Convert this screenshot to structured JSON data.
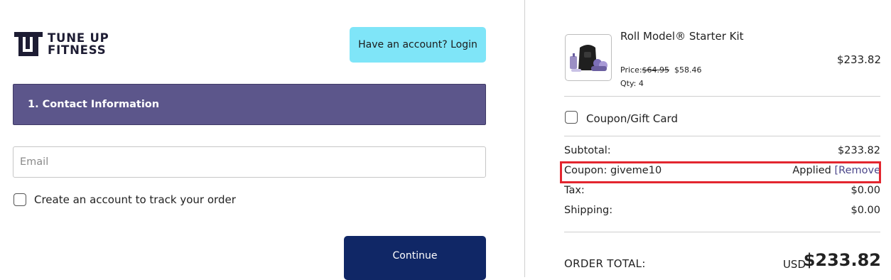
{
  "brand": {
    "line1": "TUNE UP",
    "line2": "FITNESS",
    "color": "#1d1c33"
  },
  "header": {
    "login_label": "Have an account? Login"
  },
  "contact": {
    "section_title": "1. Contact Information",
    "email_placeholder": "Email",
    "email_value": "",
    "create_account_label": "Create an account to track your order",
    "create_account_checked": false,
    "continue_label": "Continue"
  },
  "cart": {
    "item": {
      "name": "Roll Model® Starter Kit",
      "price_label": "Price:",
      "old_price": "$64.95",
      "new_price": "$58.46",
      "qty_label": "Qty:",
      "qty": "4",
      "line_total": "$233.82"
    },
    "coupon_toggle_label": "Coupon/Gift Card",
    "coupon_toggle_checked": false,
    "summary": {
      "subtotal_label": "Subtotal:",
      "subtotal_value": "$233.82",
      "coupon_label": "Coupon: giveme10",
      "coupon_status": "Applied",
      "coupon_remove_label": "Remove",
      "tax_label": "Tax:",
      "tax_value": "$0.00",
      "shipping_label": "Shipping:",
      "shipping_value": "$0.00",
      "total_label": "ORDER TOTAL:",
      "total_currency": "USD",
      "total_value": "$233.82"
    }
  },
  "colors": {
    "accent_header": "#5c568b",
    "login_button": "#7fe5f8",
    "continue_button": "#102766",
    "highlight_border": "#e3262f"
  }
}
